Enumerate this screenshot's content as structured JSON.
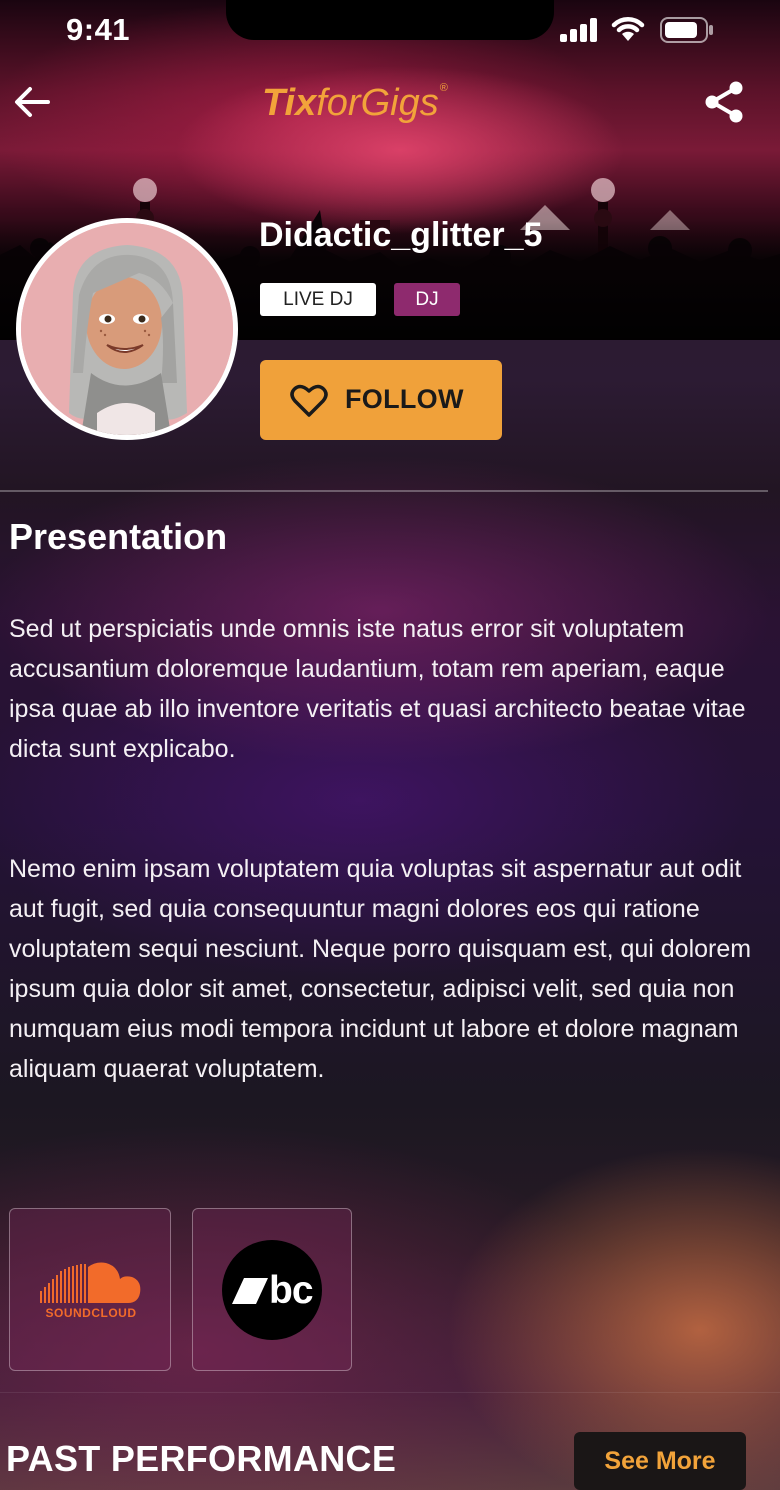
{
  "status_bar": {
    "time": "9:41"
  },
  "header": {
    "logo": {
      "part1": "Tix",
      "part2": "for",
      "part3": "Gigs",
      "reg": "®"
    },
    "back_icon": "arrow-left-icon",
    "share_icon": "share-icon"
  },
  "profile": {
    "username": "Didactic_glitter_5",
    "tags": [
      "LIVE DJ",
      "DJ"
    ],
    "follow_label": "FOLLOW"
  },
  "presentation": {
    "title": "Presentation",
    "paragraphs": [
      "Sed ut perspiciatis unde omnis iste natus error sit voluptatem accusantium doloremque laudantium, totam rem aperiam, eaque ipsa quae ab illo inventore veritatis et quasi architecto beatae vitae dicta sunt explicabo.",
      "Nemo enim ipsam voluptatem quia voluptas sit aspernatur aut odit aut fugit, sed quia consequuntur magni dolores eos qui ratione voluptatem sequi nesciunt. Neque porro quisquam est, qui dolorem ipsum quia dolor sit amet, consectetur, adipisci velit, sed quia non numquam eius modi tempora incidunt ut labore et dolore magnam aliquam quaerat voluptatem."
    ]
  },
  "socials": [
    {
      "name": "soundcloud",
      "label": "SOUNDCLOUD",
      "color": "#f26b2a"
    },
    {
      "name": "bandcamp",
      "label": "bc"
    }
  ],
  "past_performance": {
    "title": "PAST PERFORMANCE",
    "see_more_label": "See More"
  },
  "colors": {
    "accent": "#f0a13a",
    "tag_dj": "#8e2a6e",
    "soundcloud": "#f26b2a"
  }
}
